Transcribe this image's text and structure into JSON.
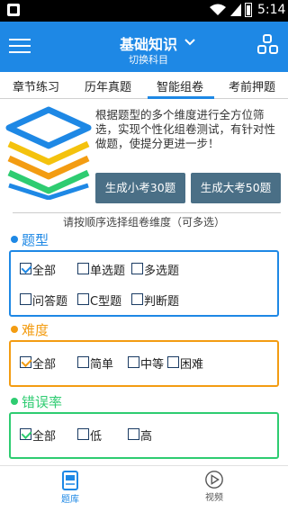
{
  "status_bar": {
    "time": "5:14"
  },
  "appbar": {
    "title": "基础知识",
    "subtitle": "切换科目"
  },
  "tabs": [
    {
      "label": "章节练习",
      "active": false
    },
    {
      "label": "历年真题",
      "active": false
    },
    {
      "label": "智能组卷",
      "active": true
    },
    {
      "label": "考前押题",
      "active": false
    }
  ],
  "intro": {
    "text": "根据题型的多个维度进行全方位筛选，实现个性化组卷测试，有针对性做题，使提分更进一步！",
    "btn_small": "生成小考30题",
    "btn_big": "生成大考50题"
  },
  "hint": "请按顺序选择组卷维度（可多选）",
  "sections": {
    "type": {
      "title": "题型",
      "color": "#1e88e5",
      "options": [
        {
          "label": "全部",
          "checked": true
        },
        {
          "label": "单选题",
          "checked": false
        },
        {
          "label": "多选题",
          "checked": false
        },
        {
          "label": "问答题",
          "checked": false
        },
        {
          "label": "C型题",
          "checked": false
        },
        {
          "label": "判断题",
          "checked": false
        }
      ]
    },
    "difficulty": {
      "title": "难度",
      "color": "#f39c12",
      "options": [
        {
          "label": "全部",
          "checked": true
        },
        {
          "label": "简单",
          "checked": false
        },
        {
          "label": "中等",
          "checked": false
        },
        {
          "label": "困难",
          "checked": false
        }
      ]
    },
    "error_rate": {
      "title": "错误率",
      "color": "#2ecc71",
      "options": [
        {
          "label": "全部",
          "checked": true
        },
        {
          "label": "低",
          "checked": false
        },
        {
          "label": "高",
          "checked": false
        }
      ]
    }
  },
  "bottom_nav": [
    {
      "label": "题库",
      "icon": "question-bank-icon",
      "active": true
    },
    {
      "label": "视频",
      "icon": "play-circle-icon",
      "active": false
    }
  ],
  "colors": {
    "primary": "#1e88e5",
    "button": "#4a6f86",
    "orange": "#f39c12",
    "green": "#2ecc71"
  }
}
